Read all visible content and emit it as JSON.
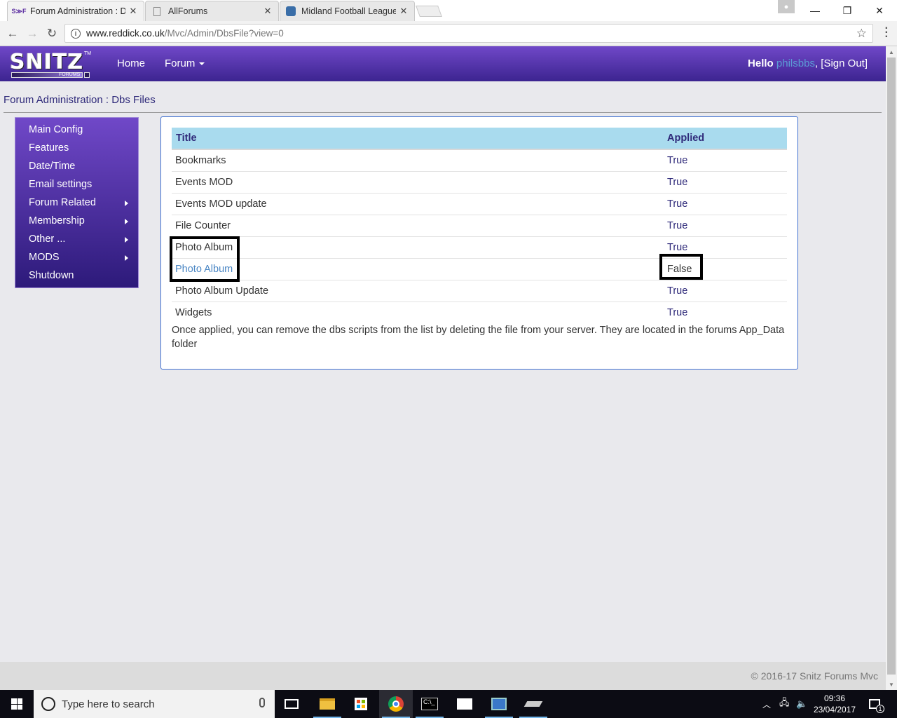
{
  "browser": {
    "tabs": [
      {
        "label": "Forum Administration : D",
        "favicon": "S≫F"
      },
      {
        "label": "AllForums",
        "favicon": "page-icon"
      },
      {
        "label": "Midland Football League",
        "favicon": "ball-icon"
      }
    ],
    "url_host": "www.reddick.co.uk",
    "url_path": "/Mvc/Admin/DbsFile?view=0"
  },
  "navbar": {
    "logo_text": "SNITZ",
    "logo_sub": "FORUMS",
    "logo_tm": "TM",
    "home": "Home",
    "forum": "Forum",
    "hello": "Hello",
    "username": "philsbbs",
    "separator": ",",
    "signout": "[Sign Out]"
  },
  "breadcrumb": "Forum Administration : Dbs Files",
  "sidebar": {
    "items": [
      {
        "label": "Main Config"
      },
      {
        "label": "Features"
      },
      {
        "label": "Date/Time"
      },
      {
        "label": "Email settings"
      },
      {
        "label": "Forum Related"
      },
      {
        "label": "Membership"
      },
      {
        "label": "Other ..."
      },
      {
        "label": "MODS"
      },
      {
        "label": "Shutdown"
      }
    ]
  },
  "table": {
    "headers": {
      "title": "Title",
      "applied": "Applied"
    },
    "rows": [
      {
        "title": "Bookmarks",
        "applied": "True"
      },
      {
        "title": "Events MOD",
        "applied": "True"
      },
      {
        "title": "Events MOD update",
        "applied": "True"
      },
      {
        "title": "File Counter",
        "applied": "True"
      },
      {
        "title": "Photo Album",
        "applied": "True"
      },
      {
        "title": "Photo Album",
        "applied": "False"
      },
      {
        "title": "Photo Album Update",
        "applied": "True"
      },
      {
        "title": "Widgets",
        "applied": "True"
      }
    ]
  },
  "note": "Once applied, you can remove the dbs scripts from the list by deleting the file from your server. They are located in the forums App_Data folder",
  "footer": "© 2016-17 Snitz Forums Mvc",
  "taskbar": {
    "search_placeholder": "Type here to search",
    "time": "09:36",
    "date": "23/04/2017",
    "notification_count": "1"
  },
  "colors": {
    "navbar_top": "#7048c8",
    "navbar_bottom": "#3c2490",
    "table_header": "#a9dbee",
    "link": "#4a86c4",
    "panel_border": "#3f6fd0"
  }
}
